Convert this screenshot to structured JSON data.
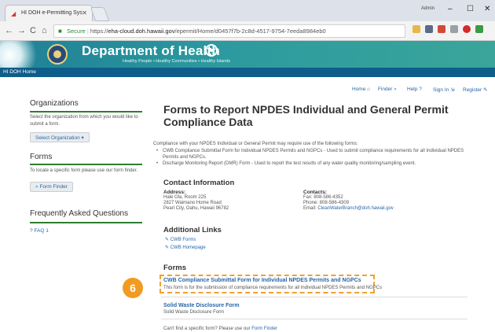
{
  "browser": {
    "tab_title": "HI DOH e-Permitting Sys",
    "profile_name": "Admin",
    "secure_label": "Secure",
    "url_prefix": "https://",
    "url_host": "eha-cloud.doh.hawaii.gov",
    "url_path": "/epermit/Home/d0457f7b-2c8d-4517-9754-7eeda8984eb0",
    "icons": [
      "back-icon",
      "forward-icon",
      "reload-icon",
      "home-icon",
      "lock-icon",
      "star-icon",
      "minimize-icon",
      "maximize-icon",
      "close-icon"
    ]
  },
  "site": {
    "department": "Department of Health",
    "tagline": "Healthy People • Healthy Communities • Healthy Islands",
    "home_link": "HI DOH Home"
  },
  "toplinks": {
    "home": "Home",
    "finder": "Finder",
    "help": "Help",
    "signin": "Sign In",
    "register": "Register"
  },
  "sidebar": {
    "org_heading": "Organizations",
    "org_text": "Select the organization from which you would like to submit a form.",
    "org_button": "Select Organization",
    "forms_heading": "Forms",
    "forms_text": "To locate a specific form please use our form finder.",
    "form_finder_button": "Form Finder",
    "faq_heading": "Frequently Asked Questions",
    "faq_link": "FAQ 1"
  },
  "main": {
    "title": "Forms to Report NPDES Individual and General Permit Compliance Data",
    "intro": "Compliance with your NPDES Individual or General Permit may require use of the following forms:",
    "bullets": [
      "CWB Compliance Submittal Form for Individual NPDES Permits and NGPCs - Used to submit compliance requirements for all Individual NPDES Permits and NGPCs.",
      "Discharge Monitoring Report (DMR) Form - Used to report the test results of any water quality monitoring/sampling event."
    ],
    "contact_heading": "Contact Information",
    "address_label": "Address:",
    "address_lines": [
      "Hale Ola, Room 225",
      "2827 Waimano Home Road",
      "Pearl City, Oahu, Hawaii 96782"
    ],
    "contacts_label": "Contacts:",
    "fax": "Fax: 808-586-4352",
    "phone": "Phone: 808-586-4309",
    "email_prefix": "Email: ",
    "email": "CleanWaterBranch@doh.hawaii.gov",
    "links_heading": "Additional Links",
    "links": [
      "CWB Forms",
      "CWB Homepage"
    ],
    "forms_heading": "Forms",
    "callout_number": "6",
    "forms": [
      {
        "title": "CWB Compliance Submittal Form for Individual NPDES Permits and NGPCs",
        "desc": "This form is for the submission of compliance requirements for all Individual NPDES Permits and NGPCs"
      },
      {
        "title": "Solid Waste Disclosure Form",
        "desc": "Solid Waste Disclosure Form"
      }
    ],
    "footer_text": "Can't find a specific form? Please use our ",
    "footer_link": "Form Finder"
  },
  "colors": {
    "header_teal": "#2a8f9c",
    "nav_blue": "#0f5d8a",
    "link_blue": "#2966a8",
    "rule_green": "#2e7d32",
    "callout_orange": "#f29b22"
  }
}
